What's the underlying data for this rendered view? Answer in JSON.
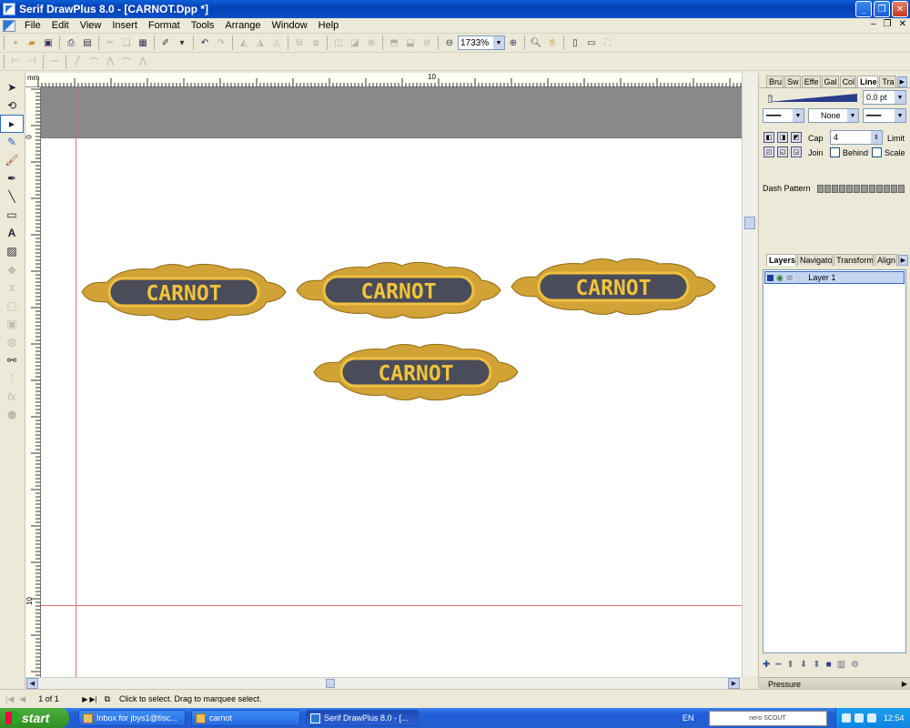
{
  "window": {
    "title": "Serif DrawPlus 8.0 - [CARNOT.Dpp *]"
  },
  "menu": [
    "File",
    "Edit",
    "View",
    "Insert",
    "Format",
    "Tools",
    "Arrange",
    "Window",
    "Help"
  ],
  "toolbar": {
    "zoom_value": "1733%"
  },
  "ruler": {
    "unit": "mm",
    "top_label": "10",
    "left_top_label": "0",
    "left_bottom_label": "10"
  },
  "canvas": {
    "plaques": [
      {
        "text": "CARNOT"
      },
      {
        "text": "CARNOT"
      },
      {
        "text": "CARNOT"
      },
      {
        "text": "CARNOT"
      }
    ],
    "colors": {
      "plaque_fill": "#4a4d59",
      "plaque_text": "#f2c33c",
      "ornament": "#d1a235",
      "guide": "#e07070",
      "band": "#898989"
    }
  },
  "right_panel": {
    "top_tabs": [
      "Bru",
      "Sw",
      "Effe",
      "Gal",
      "Col",
      "Line",
      "Tra"
    ],
    "active_top_tab": "Line",
    "line": {
      "width_value": "0.0 pt",
      "style_value": "None",
      "cap_label": "Cap",
      "join_label": "Join",
      "limit_label": "Limit",
      "limit_value": "4",
      "behind_label": "Behind",
      "scale_label": "Scale",
      "dash_label": "Dash Pattern"
    },
    "bottom_tabs": [
      "Layers",
      "Navigato",
      "Transform",
      "Align"
    ],
    "active_bottom_tab": "Layers",
    "layers": [
      {
        "name": "Layer 1"
      }
    ],
    "pressure_label": "Pressure"
  },
  "status": {
    "page": "1 of 1",
    "hint": "Click to select. Drag to marquee select."
  },
  "taskbar": {
    "start": "start",
    "tasks": [
      {
        "label": "Inbox for jbys1@tisc..."
      },
      {
        "label": "carnot"
      },
      {
        "label": "Serif DrawPlus 8.0 - [..."
      }
    ],
    "lang": "EN",
    "search": "nero SCOUT",
    "clock": "12:54"
  }
}
